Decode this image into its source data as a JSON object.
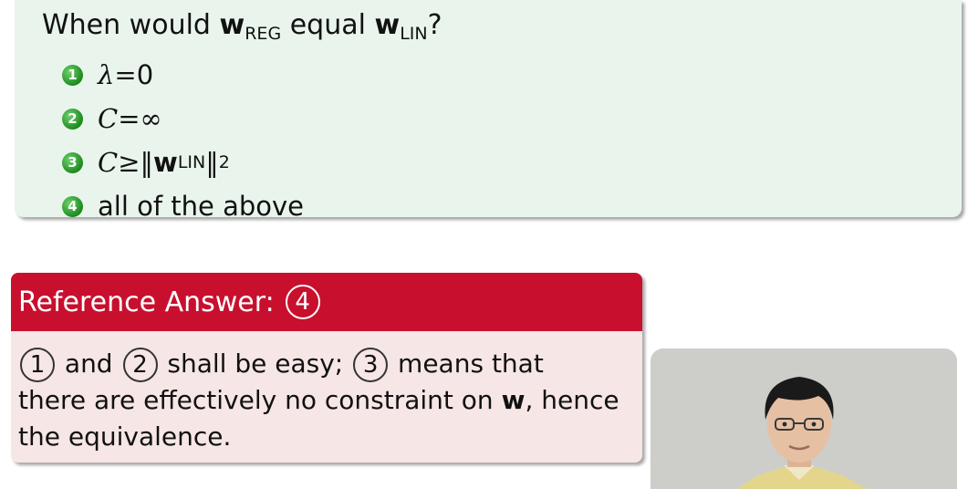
{
  "question": {
    "prefix": "When would",
    "w1": "w",
    "w1_sub": "REG",
    "middle": "equal",
    "w2": "w",
    "w2_sub": "LIN",
    "suffix": "?"
  },
  "options": [
    {
      "num": "1",
      "sym": "λ",
      "op": " = ",
      "val": "0"
    },
    {
      "num": "2",
      "sym": "C",
      "op": " = ",
      "val": "∞"
    },
    {
      "num": "3",
      "sym": "C",
      "op": " ≥ ",
      "norm_open": "‖",
      "w": "w",
      "w_sub": "LIN",
      "norm_close": "‖",
      "exp": "2"
    },
    {
      "num": "4",
      "text": "all of the above"
    }
  ],
  "answer": {
    "header": "Reference Answer:",
    "answer_num": "4",
    "circle1": "1",
    "and": "and",
    "circle2": "2",
    "easy": "shall be easy;",
    "circle3": "3",
    "means": "means that",
    "line2a": "there are effectively no constraint on",
    "w": "w",
    "line2b": ", hence",
    "line3": "the equivalence."
  }
}
